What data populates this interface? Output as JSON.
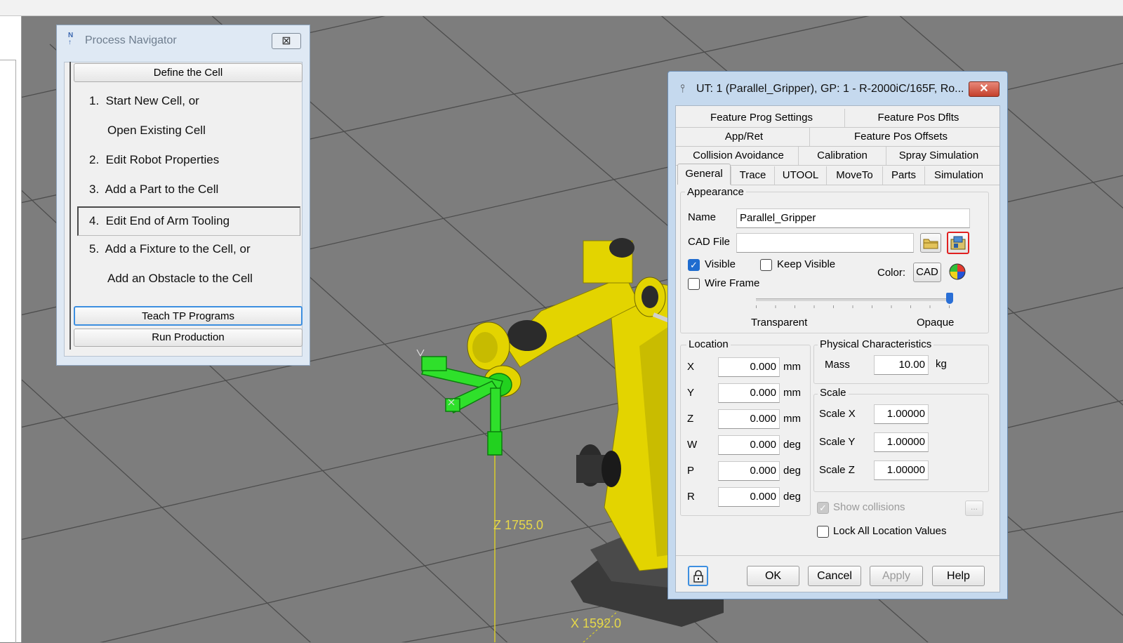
{
  "viewport": {
    "axis_z_label": "Z 1755.0",
    "axis_x_label": "X 1592.0",
    "colors": {
      "floor": "#7d7d7d",
      "grid": "#4a4a4a",
      "robot": "#e3d400",
      "tool": "#18d11a",
      "axis": "#e6d84a"
    }
  },
  "process_navigator": {
    "title": "Process Navigator",
    "title_icon": "process-navigator-icon",
    "define_cell_label": "Define the Cell",
    "steps": [
      "1.  Start New Cell, or",
      "Open Existing Cell",
      "2.  Edit Robot Properties",
      "3.  Add a Part to the Cell",
      "4.  Edit End of Arm Tooling",
      "5.  Add a Fixture to the Cell, or",
      "Add an Obstacle to the Cell"
    ],
    "teach_label": "Teach TP Programs",
    "run_label": "Run Production"
  },
  "dialog": {
    "title": "UT: 1  (Parallel_Gripper), GP: 1 - R-2000iC/165F, Ro...",
    "title_icon": "tool-icon",
    "tabs_row1": [
      "Feature Prog Settings",
      "Feature Pos Dflts"
    ],
    "tabs_row2": [
      "App/Ret",
      "Feature Pos Offsets"
    ],
    "tabs_row3": [
      "Collision Avoidance",
      "Calibration",
      "Spray Simulation"
    ],
    "tabs_row4": [
      "General",
      "Trace",
      "UTOOL",
      "MoveTo",
      "Parts",
      "Simulation"
    ],
    "active_tab": "General",
    "appearance": {
      "group_label": "Appearance",
      "name_label": "Name",
      "name_value": "Parallel_Gripper",
      "cad_label": "CAD File",
      "cad_value": "",
      "visible_label": "Visible",
      "visible_checked": true,
      "keep_visible_label": "Keep Visible",
      "keep_visible_checked": false,
      "wire_frame_label": "Wire Frame",
      "wire_frame_checked": false,
      "color_label": "Color:",
      "cad_button_label": "CAD",
      "transparent_label": "Transparent",
      "opaque_label": "Opaque",
      "opacity": 1.0
    },
    "location": {
      "group_label": "Location",
      "rows": [
        {
          "label": "X",
          "value": "0.000",
          "unit": "mm"
        },
        {
          "label": "Y",
          "value": "0.000",
          "unit": "mm"
        },
        {
          "label": "Z",
          "value": "0.000",
          "unit": "mm"
        },
        {
          "label": "W",
          "value": "0.000",
          "unit": "deg"
        },
        {
          "label": "P",
          "value": "0.000",
          "unit": "deg"
        },
        {
          "label": "R",
          "value": "0.000",
          "unit": "deg"
        }
      ]
    },
    "physical": {
      "group_label": "Physical Characteristics",
      "mass_label": "Mass",
      "mass_value": "10.00",
      "mass_unit": "kg"
    },
    "scale": {
      "group_label": "Scale",
      "rows": [
        {
          "label": "Scale X",
          "value": "1.00000"
        },
        {
          "label": "Scale Y",
          "value": "1.00000"
        },
        {
          "label": "Scale Z",
          "value": "1.00000"
        }
      ]
    },
    "show_collisions_label": "Show collisions",
    "show_collisions_checked": true,
    "ellipsis_label": "...",
    "lock_all_label": "Lock All Location Values",
    "lock_all_checked": false,
    "buttons": {
      "ok": "OK",
      "cancel": "Cancel",
      "apply": "Apply",
      "help": "Help"
    }
  }
}
